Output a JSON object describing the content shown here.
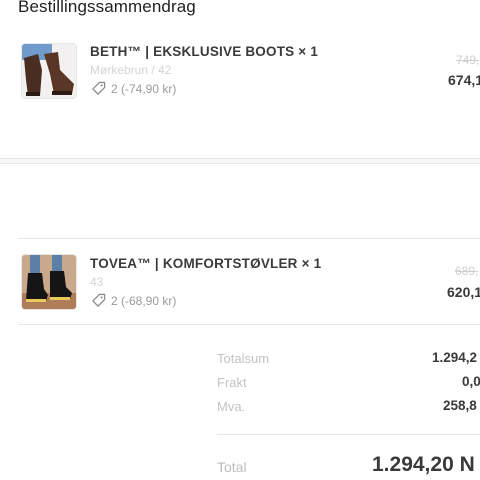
{
  "header": {
    "title": "Bestillingssammendrag"
  },
  "items": [
    {
      "name": "BETH™ | EKSKLUSIVE BOOTS × 1",
      "variant": "Mørkebrun / 42",
      "discount": "2 (-74,90 kr)",
      "old_price": "749,",
      "price": "674,1"
    },
    {
      "name": "TOVEA™ | KOMFORTSTØVLER × 1",
      "variant": "43",
      "discount": "2 (-68,90 kr)",
      "old_price": "689,",
      "price": "620,1"
    }
  ],
  "summary": {
    "subtotal_label": "Totalsum",
    "subtotal_value": "1.294,2",
    "shipping_label": "Frakt",
    "shipping_value": "0,0",
    "tax_label": "Mva.",
    "tax_value": "258,8",
    "total_label": "Total",
    "total_value": "1.294,20 N"
  },
  "colors": {
    "text": "#3a3a3a",
    "muted": "#9a9a9a",
    "border": "#e7e7e7"
  },
  "icons": {
    "discount": "tag-icon"
  }
}
